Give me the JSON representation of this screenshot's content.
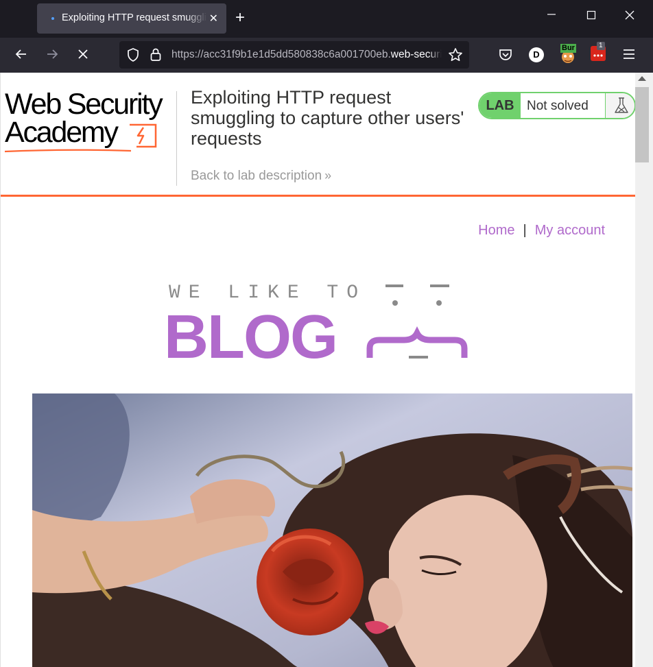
{
  "browser": {
    "tab_title": "Exploiting HTTP request smuggling to capture other users' requests",
    "url_host": "https://acc31f9b1e1d5dd580838c6a001700eb.",
    "url_rest": "web-security-academy.net/",
    "extension_badge": "1",
    "extension_label": "Bur",
    "profile_initial": "D"
  },
  "header": {
    "logo_line1": "Web Security",
    "logo_line2": "Academy",
    "lab_title": "Exploiting HTTP request smuggling to capture other users' requests",
    "back_link": "Back to lab description",
    "lab_badge": "LAB",
    "lab_status": "Not solved"
  },
  "nav": {
    "home": "Home",
    "separator": "|",
    "account": "My account"
  },
  "hero": {
    "tagline": "WE LIKE TO",
    "word": "BLOG"
  },
  "colors": {
    "accent_orange": "#ff6633",
    "accent_purple": "#b06acb",
    "lab_green": "#70d16d"
  }
}
